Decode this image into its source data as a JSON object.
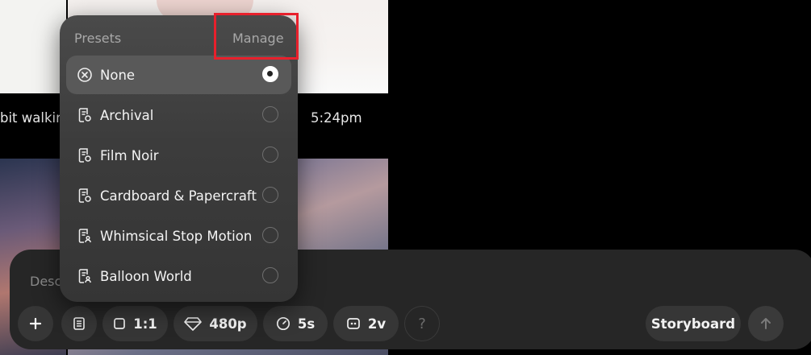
{
  "background": {
    "caption_title": "bit walking",
    "caption_time": "5:24pm"
  },
  "composer": {
    "placeholder": "Desc",
    "toolbar": {
      "add_icon": "plus-icon",
      "presets_icon": "document-icon",
      "aspect_ratio": "1:1",
      "resolution": "480p",
      "duration": "5s",
      "variations": "2v",
      "help": "?",
      "storyboard": "Storyboard",
      "send_icon": "arrow-up-icon"
    }
  },
  "presets_menu": {
    "title": "Presets",
    "manage_label": "Manage",
    "highlight_color": "#e8202c",
    "items": [
      {
        "label": "None",
        "icon": "circle-x-icon",
        "selected": true
      },
      {
        "label": "Archival",
        "icon": "document-gear-icon",
        "selected": false
      },
      {
        "label": "Film Noir",
        "icon": "document-gear-icon",
        "selected": false
      },
      {
        "label": "Cardboard & Papercraft",
        "icon": "document-gear-icon",
        "selected": false
      },
      {
        "label": "Whimsical Stop Motion",
        "icon": "document-user-icon",
        "selected": false
      },
      {
        "label": "Balloon World",
        "icon": "document-user-icon",
        "selected": false
      }
    ]
  }
}
